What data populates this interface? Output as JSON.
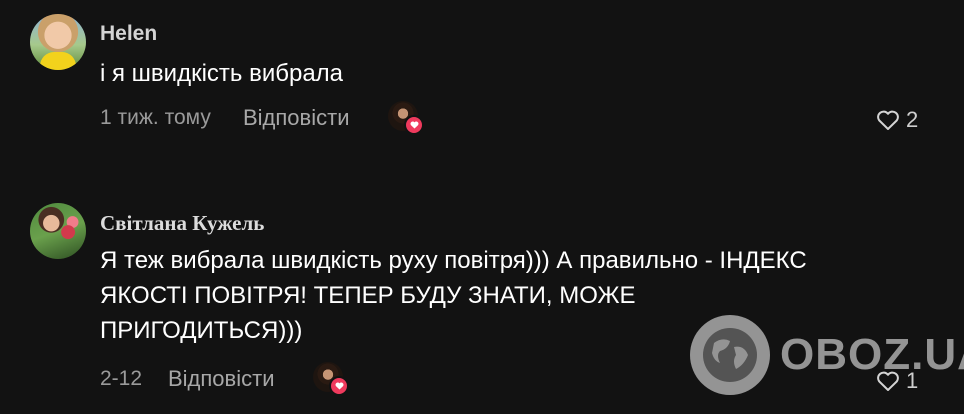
{
  "comments": [
    {
      "author": "Helen",
      "text": "і я швидкість вибрала",
      "time": "1 тиж. тому",
      "reply_label": "Відповісти",
      "likes": "2"
    },
    {
      "author": "Світлана Кужель",
      "text": "Я теж вибрала швидкість руху повітря))) А правильно - ІНДЕКС ЯКОСТІ ПОВІТРЯ! ТЕПЕР БУДУ ЗНАТИ, МОЖЕ ПРИГОДИТЬСЯ)))",
      "time": "2-12",
      "reply_label": "Відповісти",
      "likes": "1"
    }
  ],
  "watermark": {
    "text": "OBOZ.UA"
  },
  "colors": {
    "background": "#121212",
    "heart_badge": "#ef3a5d",
    "muted": "#9a9a9a"
  },
  "icons": [
    "heart-outline-icon",
    "heart-badge-icon",
    "globe-icon"
  ]
}
